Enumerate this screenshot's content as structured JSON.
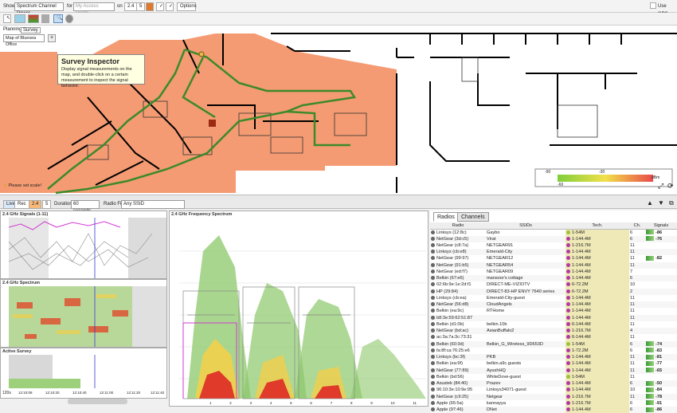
{
  "toolbar": {
    "show_label": "Show",
    "show_value": "Spectrum Channel Power",
    "for_label": "for",
    "for_placeholder": "My Access Points",
    "on_label": "on",
    "band_24": "2.4",
    "band_5": "5",
    "options_label": "Options",
    "use_gps_label": "Use GPS"
  },
  "tabs": {
    "planning": "Planning",
    "survey": "Survey"
  },
  "map_select": "Map of Bluesea Office",
  "tooltip": {
    "title": "Survey Inspector",
    "desc": "Display signal measurements on the map, and double-click on a certain measurement to inspect the signal behavior."
  },
  "map_warning": "Please set scale!",
  "legend": {
    "v1": "-90",
    "v2": "-30",
    "v3": "-60",
    "v4": "dBm"
  },
  "controls": {
    "live": "Live",
    "rec": "Rec",
    "b24": "2.4",
    "b5": "5",
    "duration_label": "Duration",
    "duration_value": "60 seconds",
    "radio_filter_label": "Radio Filter",
    "radio_filter_value": "Any SSID"
  },
  "panels": {
    "signals": "2.4 GHz Signals (1-11)",
    "spectrum": "2.4 GHz Spectrum",
    "survey": "Active Survey",
    "freq": "2.4 GHz Frequency Spectrum",
    "survey_tick": "120s",
    "times": [
      "12:10:08",
      "12:10:20",
      "12:10:40",
      "12:11:00",
      "12:11:20",
      "12:11:40"
    ],
    "freq_ticks": [
      "1",
      "2",
      "3",
      "4",
      "5",
      "6",
      "7",
      "8",
      "9",
      "10",
      "11"
    ]
  },
  "table": {
    "tab_radios": "Radios",
    "tab_channels": "Channels",
    "headers": [
      "Radio",
      "SSIDs",
      "Tech.",
      "Ch.",
      "Signals"
    ],
    "rows": [
      {
        "radio": "Linksys (12:8c)",
        "ssid": "Gaybo",
        "tech": "1-54M",
        "tg": true,
        "ch": "6",
        "sig": "-86"
      },
      {
        "radio": "NetGear (3d:c5)",
        "ssid": "Virat",
        "tech": "1-144.4M",
        "tg": false,
        "ch": "6",
        "sig": "-76"
      },
      {
        "radio": "NetGear (c8:7a)",
        "ssid": "NETGEAR91",
        "tech": "1-216.7M",
        "tg": false,
        "ch": "11",
        "sig": ""
      },
      {
        "radio": "Linksys (cb:e8)",
        "ssid": "Emerald-City",
        "tech": "1-144.4M",
        "tg": false,
        "ch": "11",
        "sig": ""
      },
      {
        "radio": "NetGear (99:97)",
        "ssid": "NETGEAR12",
        "tech": "1-144.4M",
        "tg": false,
        "ch": "11",
        "sig": "-82"
      },
      {
        "radio": "NetGear (91:b5)",
        "ssid": "NETGEAR54",
        "tech": "1-144.4M",
        "tg": false,
        "ch": "11",
        "sig": ""
      },
      {
        "radio": "NetGear (ed:f7)",
        "ssid": "NETGEAR09",
        "tech": "1-144.4M",
        "tg": false,
        "ch": "7",
        "sig": ""
      },
      {
        "radio": "Belkin (67:e6)",
        "ssid": "mansoor's cottage",
        "tech": "1-144.4M",
        "tg": false,
        "ch": "6",
        "sig": ""
      },
      {
        "radio": "02:6b:9e:1e:2d:f1",
        "ssid": "DIRECT-ME-VIZIOTV",
        "tech": "6-72.2M",
        "tg": false,
        "ch": "10",
        "sig": ""
      },
      {
        "radio": "HP (29:84)",
        "ssid": "DIRECT-83-HP ENVY 7640 series",
        "tech": "6-72.2M",
        "tg": false,
        "ch": "2",
        "sig": ""
      },
      {
        "radio": "Linksys (cb:ea)",
        "ssid": "Emerald-City-guest",
        "tech": "1-144.4M",
        "tg": false,
        "ch": "11",
        "sig": ""
      },
      {
        "radio": "NetGear (56:d8)",
        "ssid": "CloudAngels",
        "tech": "1-144.4M",
        "tg": false,
        "ch": "11",
        "sig": ""
      },
      {
        "radio": "Belkin (ea:9c)",
        "ssid": "RTHome",
        "tech": "1-144.4M",
        "tg": false,
        "ch": "11",
        "sig": ""
      },
      {
        "radio": "b8:3e:59:62:51:87",
        "ssid": "",
        "tech": "1-144.4M",
        "tg": false,
        "ch": "11",
        "sig": ""
      },
      {
        "radio": "Belkin (d1:0b)",
        "ssid": "belkin.10b",
        "tech": "6-144.4M",
        "tg": false,
        "ch": "11",
        "sig": ""
      },
      {
        "radio": "NetGear (bd:ac)",
        "ssid": "AsianBuffalo2",
        "tech": "1-216.7M",
        "tg": false,
        "ch": "4",
        "sig": ""
      },
      {
        "radio": "ac:3a:7a:3c:73:31",
        "ssid": "",
        "tech": "6-144.4M",
        "tg": false,
        "ch": "11",
        "sig": ""
      },
      {
        "radio": "Belkin (60:3d)",
        "ssid": "Belkin_G_Wireless_9D653D",
        "tech": "1-54M",
        "tg": true,
        "ch": "6",
        "sig": "-74"
      },
      {
        "radio": "fa:8f:ca:76:25:e6",
        "ssid": "",
        "tech": "1-72.2M",
        "tg": false,
        "ch": "6",
        "sig": "-83"
      },
      {
        "radio": "Linksys (bc:3f)",
        "ssid": "PKB",
        "tech": "1-144.4M",
        "tg": false,
        "ch": "11",
        "sig": "-81"
      },
      {
        "radio": "Belkin (ea:9f)",
        "ssid": "belkin.a9c.guests",
        "tech": "1-144.4M",
        "tg": false,
        "ch": "11",
        "sig": "-77"
      },
      {
        "radio": "NetGear (77:89)",
        "ssid": "AyushHQ",
        "tech": "1-144.4M",
        "tg": false,
        "ch": "11",
        "sig": "-65"
      },
      {
        "radio": "Belkin (bd:56)",
        "ssid": "WhiteDove-guest",
        "tech": "1-54M",
        "tg": true,
        "ch": "11",
        "sig": ""
      },
      {
        "radio": "Asustek (84:40)",
        "ssid": "Prazev",
        "tech": "1-144.4M",
        "tg": false,
        "ch": "6",
        "sig": "-50"
      },
      {
        "radio": "96:10:3e:10:9e:95",
        "ssid": "Linksys34071-guest",
        "tech": "1-144.4M",
        "tg": false,
        "ch": "10",
        "sig": "-84"
      },
      {
        "radio": "NetGear (c9:25)",
        "ssid": "Netgear",
        "tech": "1-216.7M",
        "tg": false,
        "ch": "11",
        "sig": "-78"
      },
      {
        "radio": "Apple (65:5a)",
        "ssid": "kannayya",
        "tech": "1-216.7M",
        "tg": false,
        "ch": "6",
        "sig": "-91"
      },
      {
        "radio": "Apple (97:46)",
        "ssid": "DNet",
        "tech": "1-144.4M",
        "tg": false,
        "ch": "6",
        "sig": "-86"
      }
    ]
  }
}
